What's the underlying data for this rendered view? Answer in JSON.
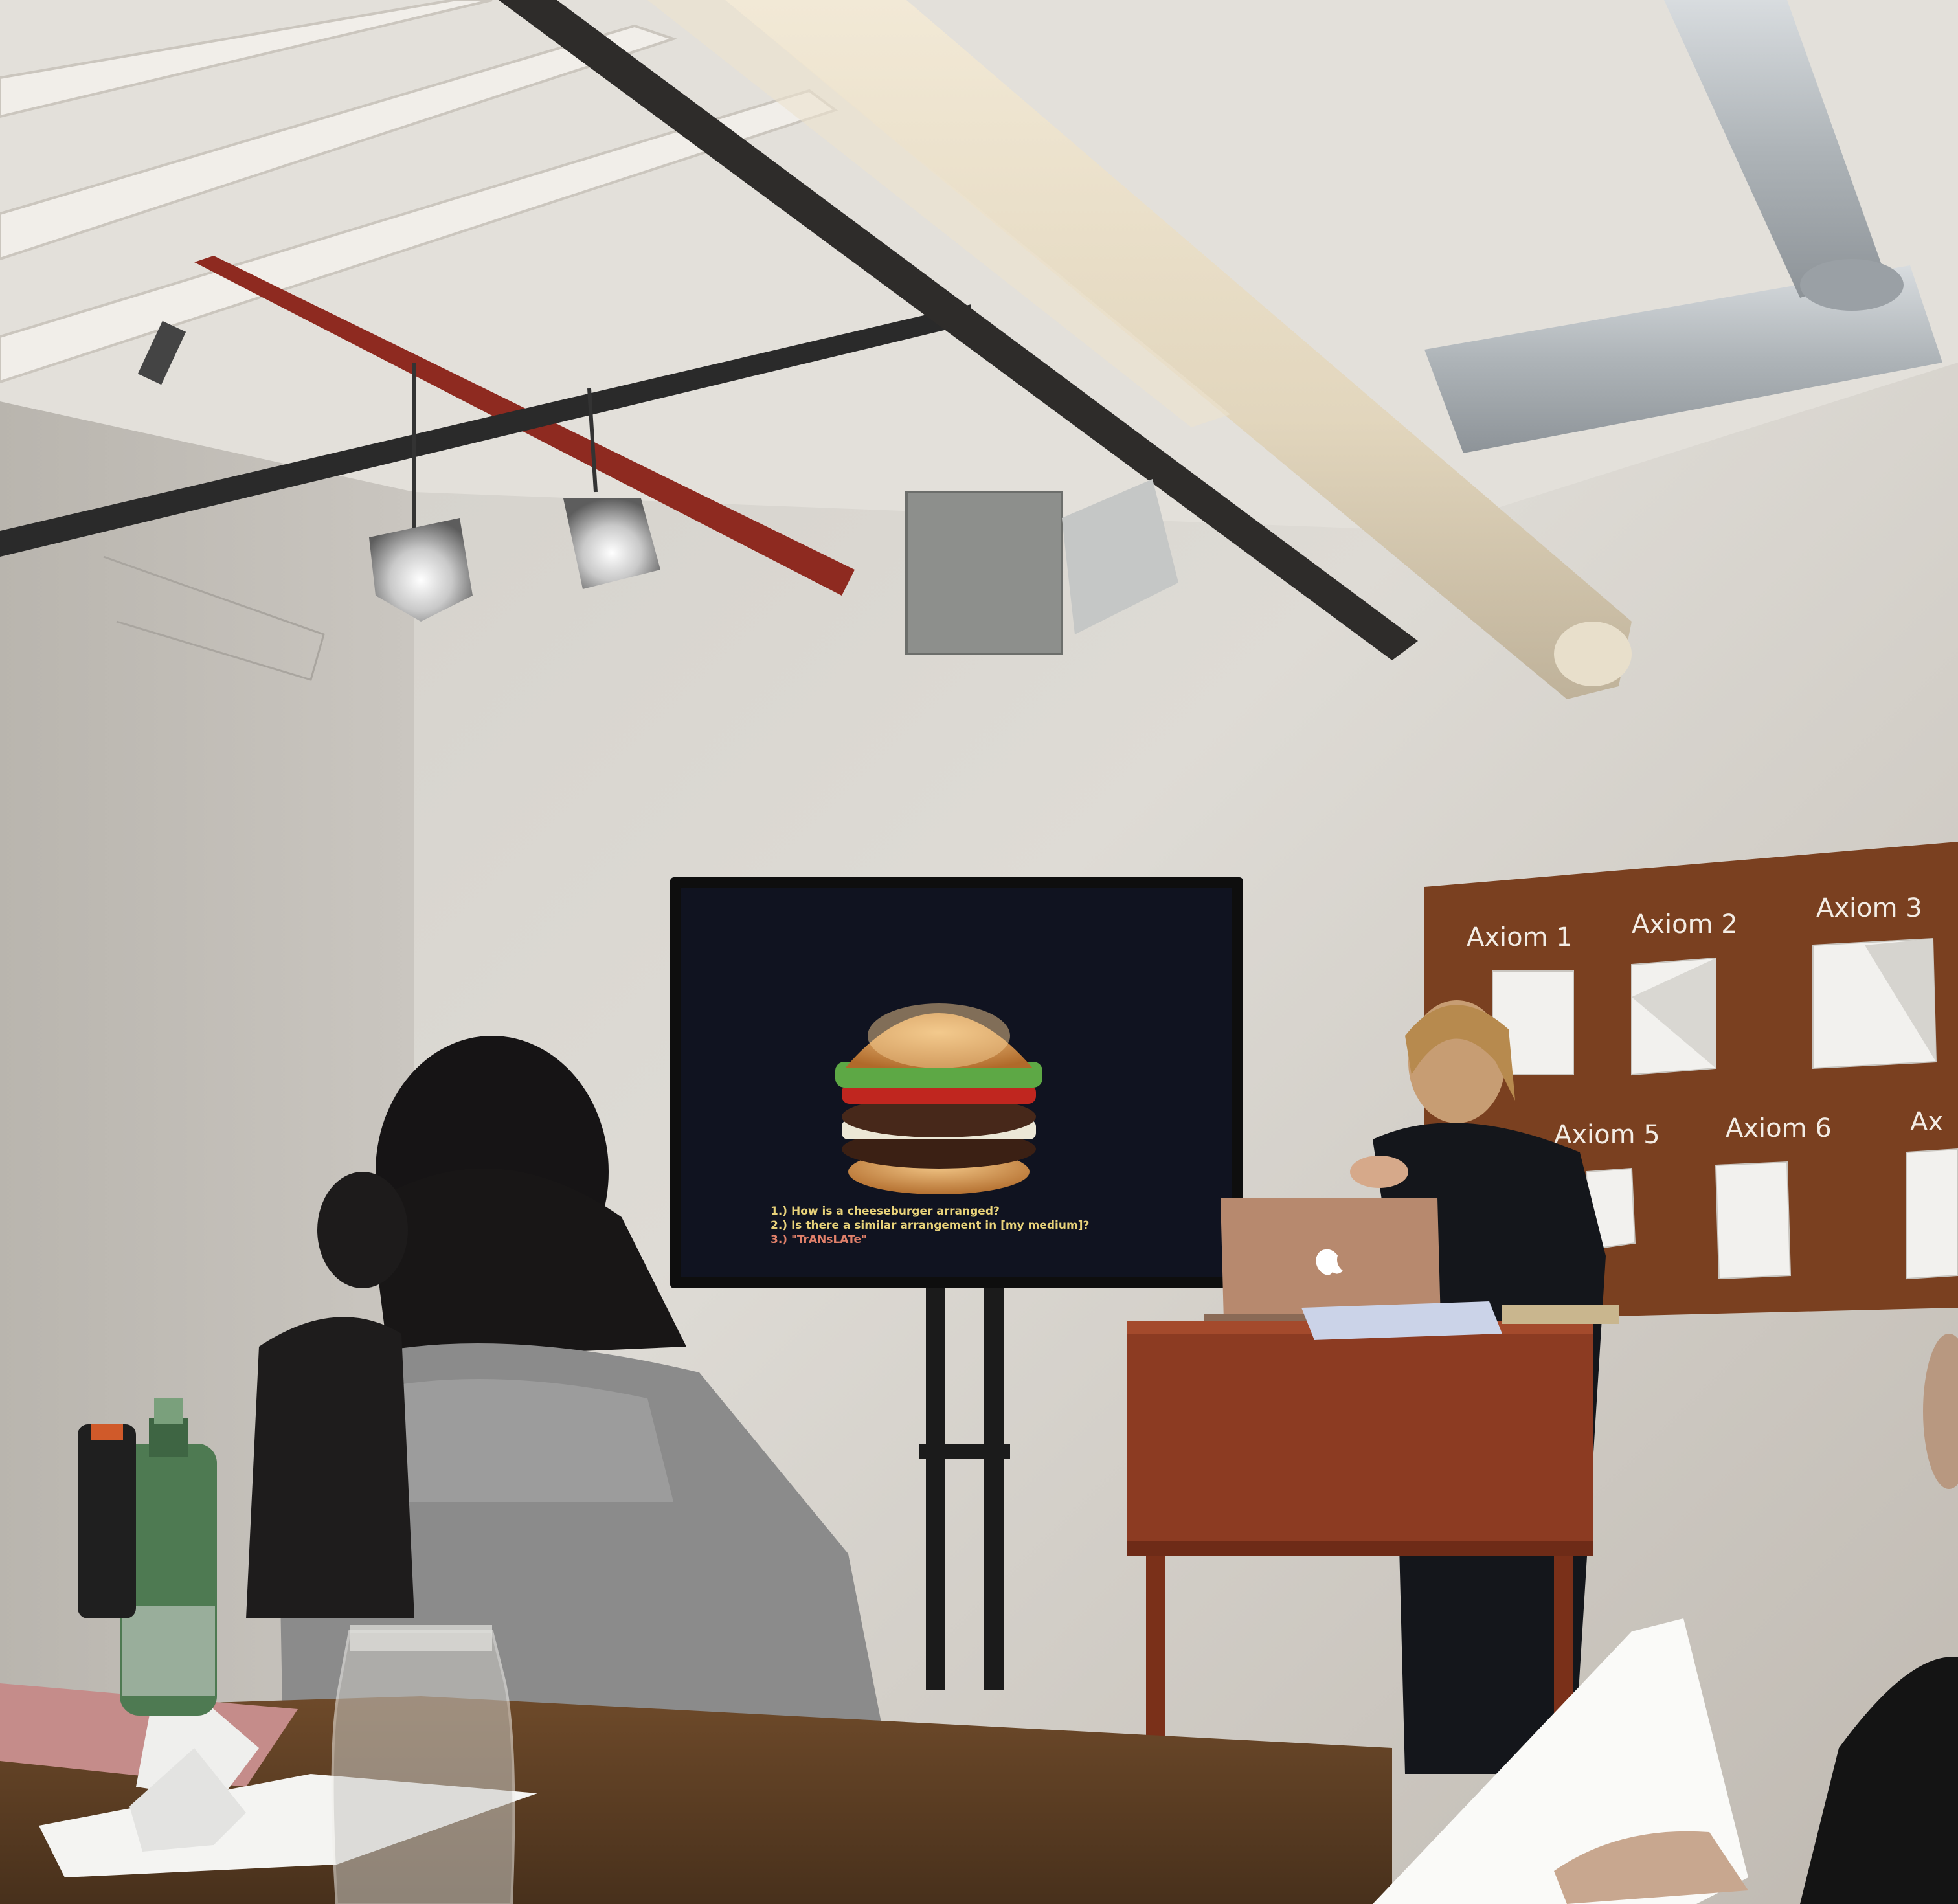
{
  "screen": {
    "lines": [
      "1.) How is a cheeseburger arranged?",
      "2.) Is there a similar arrangement in [my medium]?",
      "3.) \"TrANsLATe\""
    ]
  },
  "board": {
    "labels": [
      "Axiom 1",
      "Axiom 2",
      "Axiom 3",
      "Axiom 5",
      "Axiom 6",
      "Ax"
    ]
  },
  "colors": {
    "wall": "#d9d6d1",
    "ceiling": "#e4e1dc",
    "board": "#7a4020",
    "podium": "#8c3b22",
    "table": "#6e4a2a",
    "screen_text": "#e8d27a"
  }
}
